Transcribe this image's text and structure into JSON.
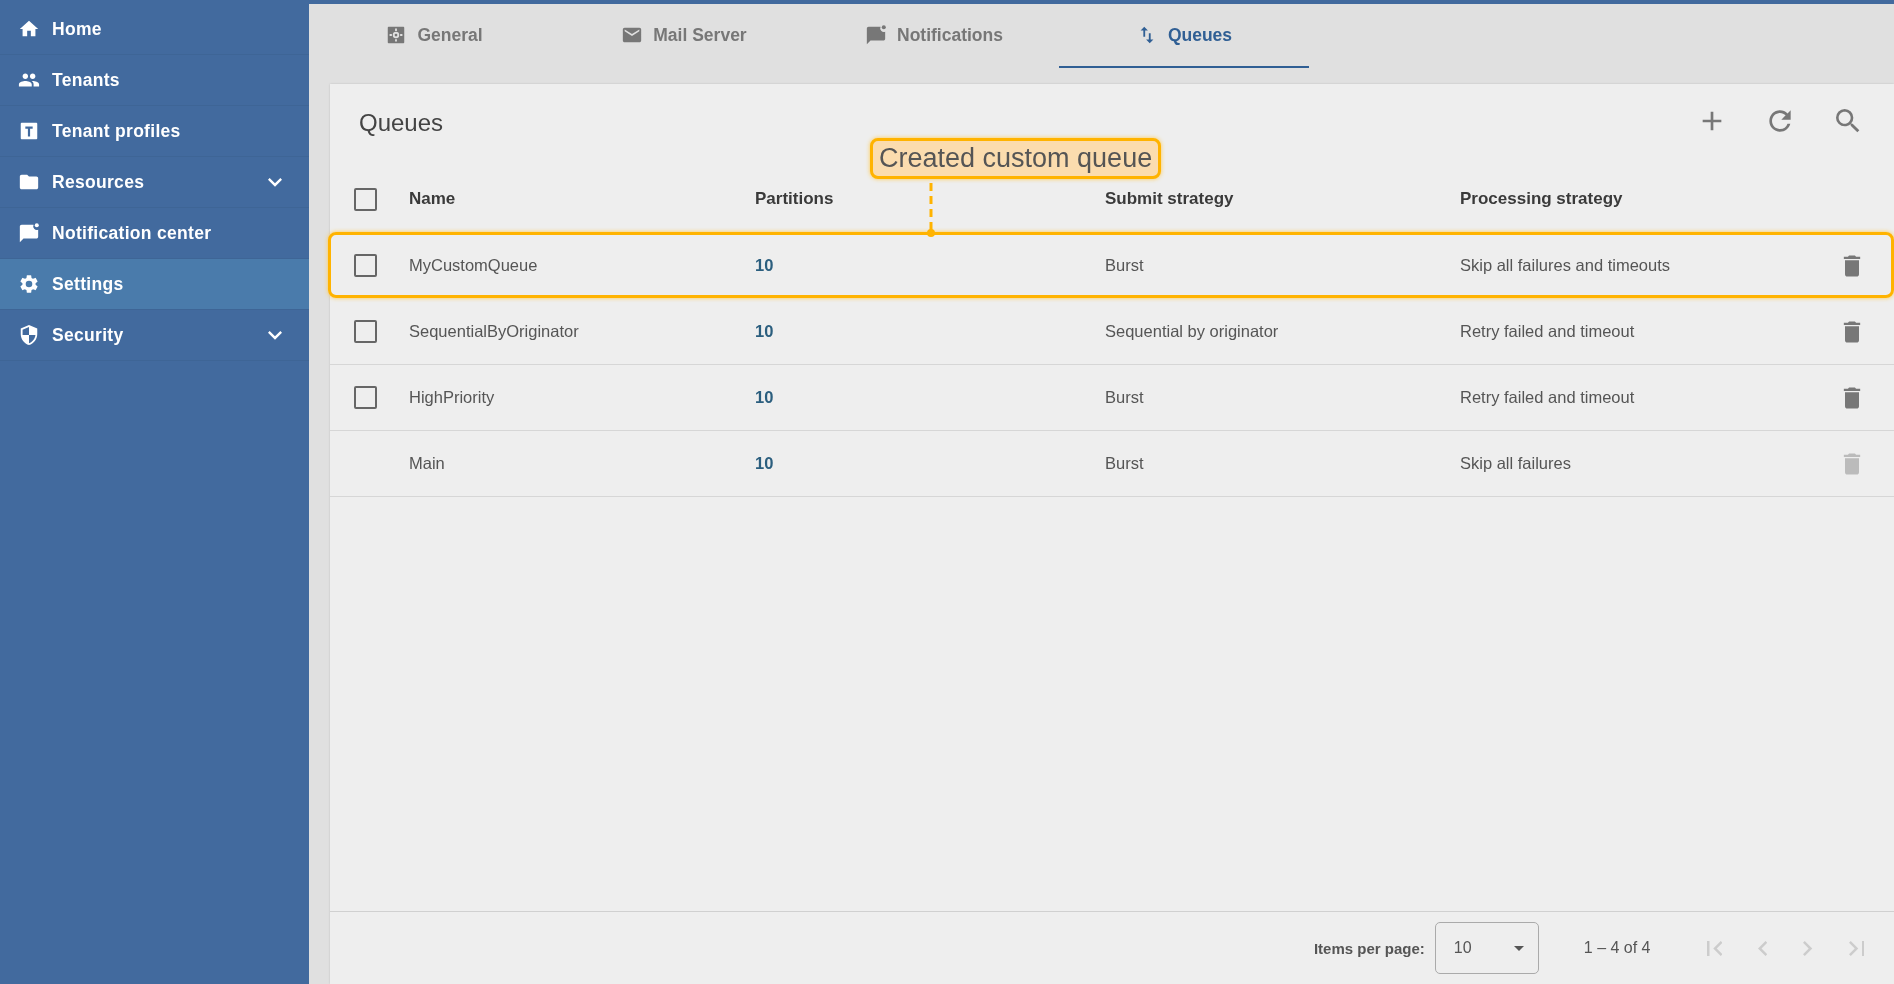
{
  "sidebar": {
    "items": [
      {
        "label": "Home",
        "selected": false,
        "expandable": false
      },
      {
        "label": "Tenants",
        "selected": false,
        "expandable": false
      },
      {
        "label": "Tenant profiles",
        "selected": false,
        "expandable": false
      },
      {
        "label": "Resources",
        "selected": false,
        "expandable": true
      },
      {
        "label": "Notification center",
        "selected": false,
        "expandable": false
      },
      {
        "label": "Settings",
        "selected": true,
        "expandable": false
      },
      {
        "label": "Security",
        "selected": false,
        "expandable": true
      }
    ]
  },
  "tabs": [
    {
      "label": "General",
      "selected": false
    },
    {
      "label": "Mail Server",
      "selected": false
    },
    {
      "label": "Notifications",
      "selected": false
    },
    {
      "label": "Queues",
      "selected": true
    }
  ],
  "card": {
    "title": "Queues",
    "annotation": {
      "text": "Created custom queue"
    },
    "table": {
      "columns": [
        "Name",
        "Partitions",
        "Submit strategy",
        "Processing strategy"
      ],
      "header_checked": false,
      "rows": [
        {
          "name": "MyCustomQueue",
          "partitions": "10",
          "submit_strategy": "Burst",
          "processing_strategy": "Skip all failures and timeouts",
          "checked": false,
          "delete_disabled": false,
          "highlighted": true
        },
        {
          "name": "SequentialByOriginator",
          "partitions": "10",
          "submit_strategy": "Sequential by originator",
          "processing_strategy": "Retry failed and timeout",
          "checked": false,
          "delete_disabled": false,
          "highlighted": false
        },
        {
          "name": "HighPriority",
          "partitions": "10",
          "submit_strategy": "Burst",
          "processing_strategy": "Retry failed and timeout",
          "checked": false,
          "delete_disabled": false,
          "highlighted": false
        },
        {
          "name": "Main",
          "partitions": "10",
          "submit_strategy": "Burst",
          "processing_strategy": "Skip all failures",
          "checked": null,
          "delete_disabled": true,
          "highlighted": false
        }
      ]
    },
    "paginator": {
      "items_per_page_label": "Items per page:",
      "page_size": "10",
      "range": "1 – 4 of 4",
      "buttons": [
        {
          "kind": "first",
          "disabled": true
        },
        {
          "kind": "prev",
          "disabled": true
        },
        {
          "kind": "next",
          "disabled": true
        },
        {
          "kind": "last",
          "disabled": true
        }
      ]
    }
  }
}
